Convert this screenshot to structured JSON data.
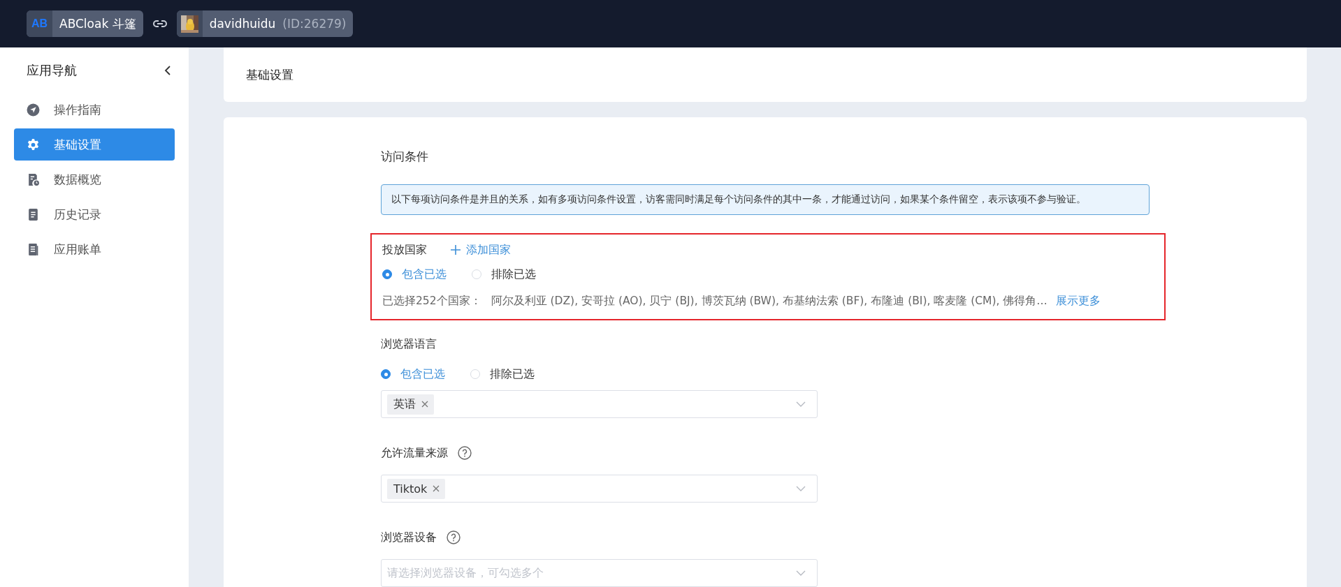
{
  "header": {
    "app_logo": "AB",
    "app_name": "ABCloak 斗篷",
    "user_name": "davidhuidu",
    "user_id": "(ID:26279)"
  },
  "sidebar": {
    "title": "应用导航",
    "items": [
      {
        "label": "操作指南",
        "selected": false
      },
      {
        "label": "基础设置",
        "selected": true
      },
      {
        "label": "数据概览",
        "selected": false
      },
      {
        "label": "历史记录",
        "selected": false
      },
      {
        "label": "应用账单",
        "selected": false
      }
    ]
  },
  "page_title": "基础设置",
  "section_title": "访问条件",
  "notice": "以下每项访问条件是并且的关系，如有多项访问条件设置，访客需同时满足每个访问条件的其中一条，才能通过访问，如果某个条件留空，表示该项不参与验证。",
  "country": {
    "label": "投放国家",
    "add_label": "添加国家",
    "highlighted": true,
    "options": [
      {
        "label": "包含已选",
        "selected": true
      },
      {
        "label": "排除已选",
        "selected": false
      }
    ],
    "summary_label": "已选择252个国家：",
    "summary": "阿尔及利亚 (DZ), 安哥拉 (AO), 贝宁 (BJ), 博茨瓦纳 (BW), 布基纳法索 (BF), 布隆迪 (BI), 喀麦隆 (CM), 佛得角…",
    "more": "展示更多"
  },
  "fields": [
    {
      "kind": "radio-select",
      "label": "浏览器语言",
      "help": false,
      "options": [
        {
          "label": "包含已选",
          "selected": true
        },
        {
          "label": "排除已选",
          "selected": false
        }
      ],
      "tags": [
        "英语"
      ]
    },
    {
      "kind": "select",
      "label": "允许流量来源",
      "help": true,
      "tags": [
        "Tiktok"
      ]
    },
    {
      "kind": "select",
      "label": "浏览器设备",
      "help": true,
      "placeholder": "请选择浏览器设备，可勾选多个"
    }
  ]
}
